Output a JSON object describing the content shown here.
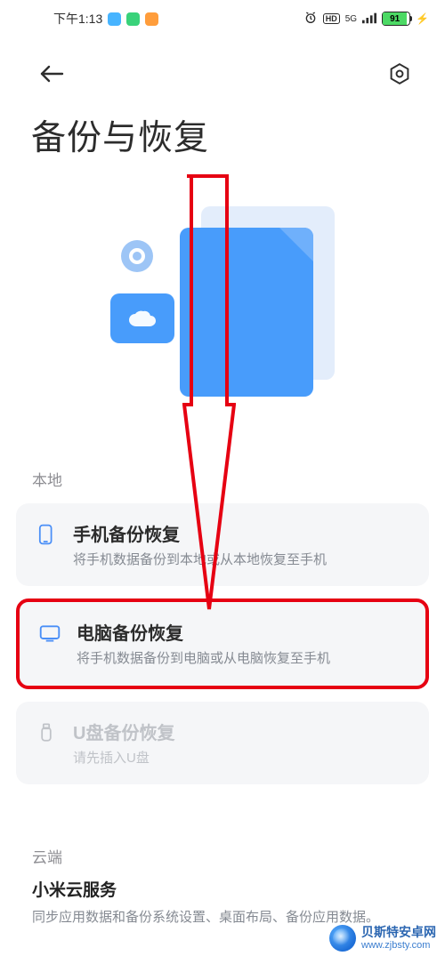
{
  "status_bar": {
    "time": "下午1:13",
    "app_icons": [
      "app-blue",
      "app-green",
      "app-orange"
    ],
    "app_colors": [
      "#47b4ff",
      "#39d27a",
      "#ff9d3b"
    ],
    "battery_pct": "91",
    "network": "5G",
    "hd": "HD"
  },
  "page": {
    "title": "备份与恢复"
  },
  "sections": {
    "local_label": "本地",
    "cloud_label": "云端"
  },
  "cards": {
    "phone": {
      "title": "手机备份恢复",
      "sub": "将手机数据备份到本地或从本地恢复至手机"
    },
    "computer": {
      "title": "电脑备份恢复",
      "sub": "将手机数据备份到电脑或从电脑恢复至手机"
    },
    "usb": {
      "title": "U盘备份恢复",
      "sub": "请先插入U盘"
    }
  },
  "cloud": {
    "title": "小米云服务",
    "sub": "同步应用数据和备份系统设置、桌面布局、备份应用数据。"
  },
  "watermark": {
    "name": "贝斯特安卓网",
    "url": "www.zjbsty.com"
  }
}
